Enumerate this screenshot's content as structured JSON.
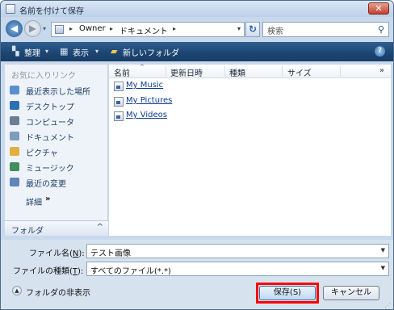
{
  "window": {
    "title": "名前を付けて保存",
    "close_glyph": "✕"
  },
  "address": {
    "back_glyph": "◀",
    "forward_glyph": "▶",
    "crumbs": [
      "Owner",
      "ドキュメント"
    ],
    "separator_glyph": "▸",
    "refresh_glyph": "↻",
    "search_placeholder": "検索"
  },
  "toolbar": {
    "organize": "整理",
    "views": "表示",
    "new_folder": "新しいフォルダ",
    "help_glyph": "?",
    "background": "#1d4674"
  },
  "navpane": {
    "favorites_heading": "お気に入りリンク",
    "items": [
      {
        "label": "最近表示した場所",
        "icon": "recent-places-icon",
        "color": "#5a8fcf"
      },
      {
        "label": "デスクトップ",
        "icon": "desktop-icon",
        "color": "#2d6fb5"
      },
      {
        "label": "コンピュータ",
        "icon": "computer-icon",
        "color": "#6b7f96"
      },
      {
        "label": "ドキュメント",
        "icon": "documents-icon",
        "color": "#7f9bbd"
      },
      {
        "label": "ピクチャ",
        "icon": "pictures-icon",
        "color": "#e0b040"
      },
      {
        "label": "ミュージック",
        "icon": "music-icon",
        "color": "#3f8e5c"
      },
      {
        "label": "最近の変更",
        "icon": "recent-changes-icon",
        "color": "#5e86b9"
      }
    ],
    "details_label": "詳細",
    "details_chevron": "»",
    "folder_bar_label": "フォルダ",
    "folder_bar_caret": "^"
  },
  "filelist": {
    "columns": [
      "名前",
      "更新日時",
      "種類",
      "サイズ"
    ],
    "more_columns_glyph": "»",
    "rows": [
      {
        "name": "My Music"
      },
      {
        "name": "My Pictures"
      },
      {
        "name": "My Videos"
      }
    ]
  },
  "form": {
    "filename_label": "ファイル名(",
    "filename_key": "N",
    "filename_label_end": "):",
    "filename_value": "テスト画像",
    "filetype_label": "ファイルの種類(",
    "filetype_key": "T",
    "filetype_label_end": "):",
    "filetype_value": "すべてのファイル(*.*)",
    "hide_folders_label": "フォルダの非表示",
    "save_label": "保存(S)",
    "cancel_label": "キャンセル",
    "highlight_color": "#ff0000"
  }
}
